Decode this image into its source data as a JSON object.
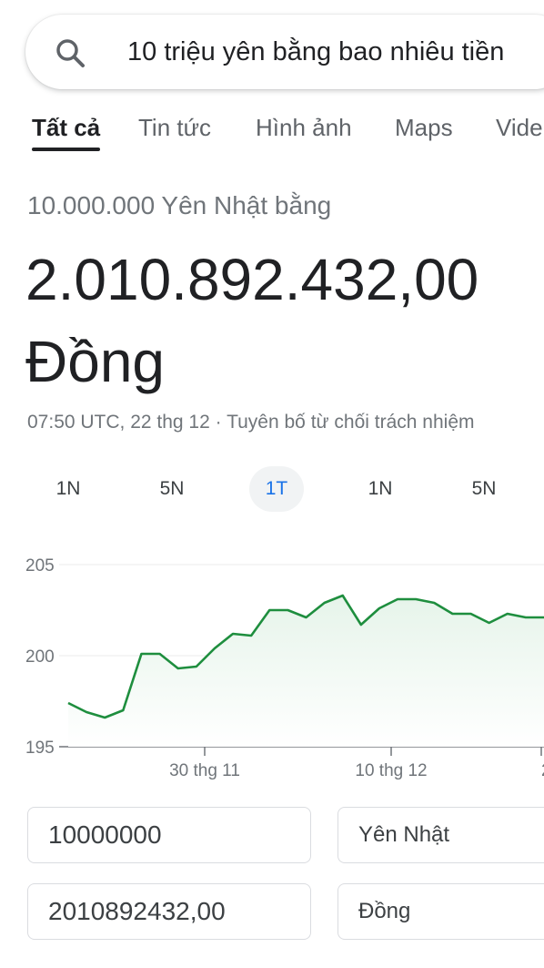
{
  "search": {
    "query": "10 triệu yên bằng bao nhiêu tiền"
  },
  "tabs": [
    {
      "label": "Tất cả",
      "active": true
    },
    {
      "label": "Tin tức"
    },
    {
      "label": "Hình ảnh"
    },
    {
      "label": "Maps"
    },
    {
      "label": "Vide"
    }
  ],
  "conversion": {
    "from_text": "10.000.000 Yên Nhật bằng",
    "result_number": "2.010.892.432,00",
    "result_currency": "Đồng",
    "meta": "07:50 UTC, 22 thg 12 · Tuyên bố từ chối trách nhiệm"
  },
  "ranges": [
    {
      "label": "1N"
    },
    {
      "label": "5N"
    },
    {
      "label": "1T",
      "active": true
    },
    {
      "label": "1N"
    },
    {
      "label": "5N"
    }
  ],
  "chart_data": {
    "type": "area",
    "y_ticks": [
      "205",
      "200",
      "195"
    ],
    "ylim": [
      195,
      205
    ],
    "x_tick_labels": [
      "30 thg 11",
      "10 thg 12",
      "2"
    ],
    "values": [
      197.4,
      196.9,
      196.6,
      197.0,
      200.1,
      200.1,
      199.3,
      199.4,
      200.4,
      201.2,
      201.1,
      202.5,
      202.5,
      202.1,
      202.9,
      203.3,
      201.7,
      202.6,
      203.1,
      203.1,
      202.9,
      202.3,
      202.3,
      201.8,
      202.3,
      202.1,
      202.1
    ],
    "color": "#1e8e3e",
    "fill_color": "#e6f4ea"
  },
  "converter": {
    "from_amount": "10000000",
    "from_unit": "Yên Nhật",
    "to_amount": "2010892432,00",
    "to_unit": "Đồng"
  }
}
